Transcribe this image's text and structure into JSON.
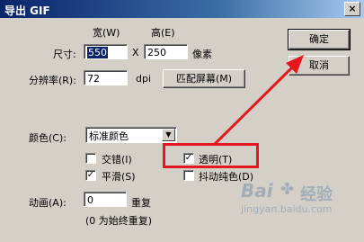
{
  "window": {
    "title": "导出 GIF",
    "close_glyph": "×"
  },
  "size": {
    "label": "尺寸:",
    "width_label": "宽(W)",
    "height_label": "高(E)",
    "width_value": "550",
    "times": "X",
    "height_value": "250",
    "unit": "像素"
  },
  "resolution": {
    "label": "分辨率(R):",
    "value": "72",
    "unit": "dpi",
    "fit_button": "匹配屏幕(M)"
  },
  "color": {
    "label": "颜色(C):",
    "selected": "标准颜色"
  },
  "options": {
    "interlace": {
      "label": "交错(I)",
      "checked": false
    },
    "transparent": {
      "label": "透明(T)",
      "checked": true
    },
    "smooth": {
      "label": "平滑(S)",
      "checked": true
    },
    "dither": {
      "label": "抖动纯色(D)",
      "checked": false
    }
  },
  "animation": {
    "label": "动画(A):",
    "value": "0",
    "repeat_label": "重复",
    "hint": "(0 为始终重复)"
  },
  "buttons": {
    "ok": "确定",
    "cancel": "取消"
  },
  "watermark": {
    "brand": "Bai",
    "brand2": "经验",
    "url": "jingyan.baidu.com"
  },
  "colors": {
    "annotation": "#e3171d",
    "titlebar": "#0a246a"
  }
}
